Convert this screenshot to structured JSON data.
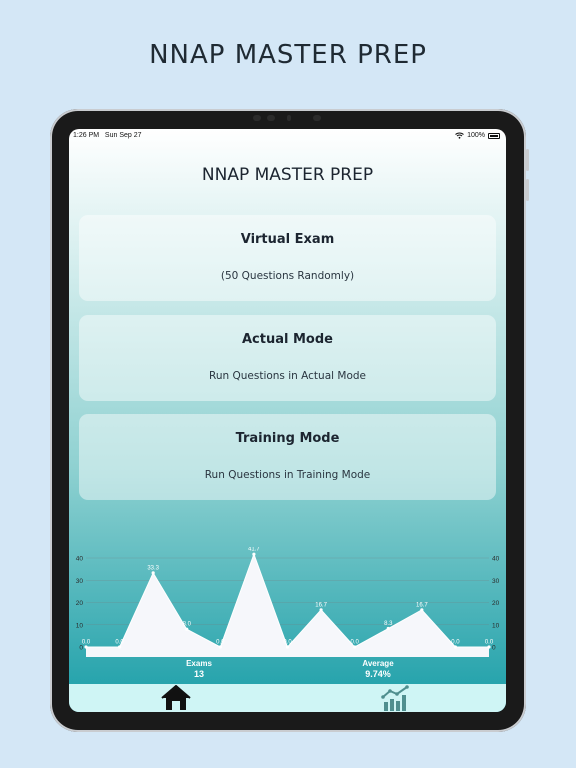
{
  "banner": {
    "title": "NNAP MASTER PREP"
  },
  "status": {
    "time": "1:26 PM",
    "date": "Sun Sep 27",
    "battery": "100%"
  },
  "app": {
    "title": "NNAP MASTER PREP"
  },
  "cards": [
    {
      "title": "Virtual Exam",
      "subtitle": "(50 Questions Randomly)"
    },
    {
      "title": "Actual Mode",
      "subtitle": "Run Questions in Actual Mode"
    },
    {
      "title": "Training Mode",
      "subtitle": "Run Questions in Training Mode"
    }
  ],
  "chart_data": {
    "type": "area",
    "x": [
      1,
      2,
      3,
      4,
      5,
      6,
      7,
      8,
      9,
      10,
      11,
      12,
      13
    ],
    "values": [
      0.0,
      0.0,
      33.3,
      8.0,
      0.0,
      41.7,
      0.0,
      16.7,
      0.0,
      8.3,
      16.7,
      0.0,
      0.0
    ],
    "value_labels": [
      "0.0",
      "0.0",
      "33.3",
      "8.0",
      "0.0",
      "41.7",
      "0.0",
      "16.7",
      "0.0",
      "8.3",
      "16.7",
      "0.0",
      "0.0"
    ],
    "y_ticks": [
      "0",
      "10",
      "20",
      "30",
      "40"
    ],
    "ylim": [
      0,
      40
    ],
    "grid": true,
    "fill_color": "#f6f7fb",
    "line_color": "#ffffff"
  },
  "stats": {
    "exams_label": "Exams",
    "exams_value": "13",
    "average_label": "Average",
    "average_value": "9.74%"
  },
  "tabs": [
    {
      "name": "home",
      "icon": "home-icon"
    },
    {
      "name": "statistics",
      "icon": "chart-icon"
    }
  ]
}
